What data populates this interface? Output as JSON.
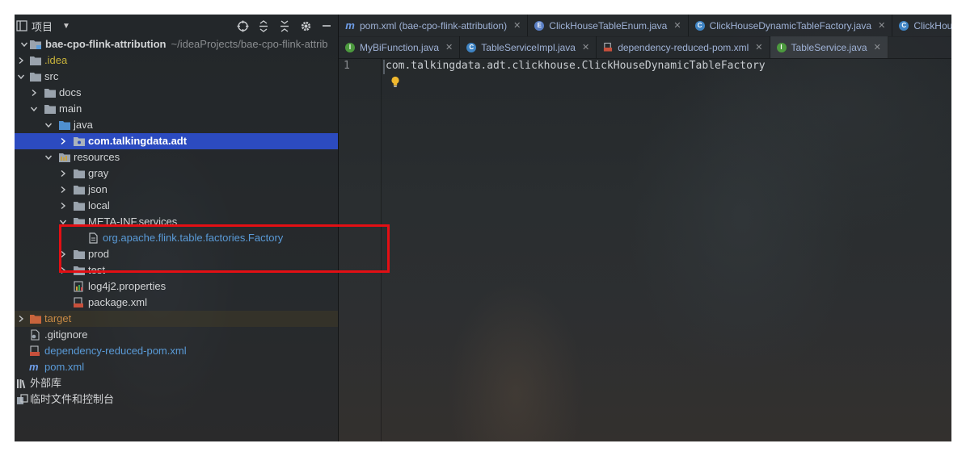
{
  "project_panel": {
    "title": "项目",
    "tree": [
      {
        "label": "bae-cpo-flink-attribution",
        "path": "~/ideaProjects/bae-cpo-flink-attrib"
      },
      {
        "label": ".idea"
      },
      {
        "label": "src"
      },
      {
        "label": "docs"
      },
      {
        "label": "main"
      },
      {
        "label": "java"
      },
      {
        "label": "com.talkingdata.adt"
      },
      {
        "label": "resources"
      },
      {
        "label": "gray"
      },
      {
        "label": "json"
      },
      {
        "label": "local"
      },
      {
        "label": "META-INF.services"
      },
      {
        "label": "org.apache.flink.table.factories.Factory"
      },
      {
        "label": "prod"
      },
      {
        "label": "test"
      },
      {
        "label": "log4j2.properties"
      },
      {
        "label": "package.xml"
      },
      {
        "label": "target"
      },
      {
        "label": ".gitignore"
      },
      {
        "label": "dependency-reduced-pom.xml"
      },
      {
        "label": "pom.xml"
      },
      {
        "label": "外部库"
      },
      {
        "label": "临时文件和控制台"
      }
    ]
  },
  "editor": {
    "tabs_row1": [
      {
        "label": "pom.xml (bae-cpo-flink-attribution)",
        "icon": "maven-m-icon"
      },
      {
        "label": "ClickHouseTableEnum.java",
        "icon": "enum-icon"
      },
      {
        "label": "ClickHouseDynamicTableFactory.java",
        "icon": "class-icon"
      },
      {
        "label": "ClickHouseD",
        "icon": "class-icon"
      }
    ],
    "tabs_row2": [
      {
        "label": "MyBiFunction.java",
        "icon": "interface-icon"
      },
      {
        "label": "TableServiceImpl.java",
        "icon": "class-icon"
      },
      {
        "label": "dependency-reduced-pom.xml",
        "icon": "xml-icon"
      },
      {
        "label": "TableService.java",
        "icon": "interface-icon"
      }
    ],
    "line_number": "1",
    "code_line": "com.talkingdata.adt.clickhouse.ClickHouseDynamicTableFactory"
  },
  "colors": {
    "selection": "#2c4bc0",
    "highlight_border": "#e30f14",
    "excluded_folder": "#c88a45",
    "link_blue": "#5a9bd8"
  }
}
